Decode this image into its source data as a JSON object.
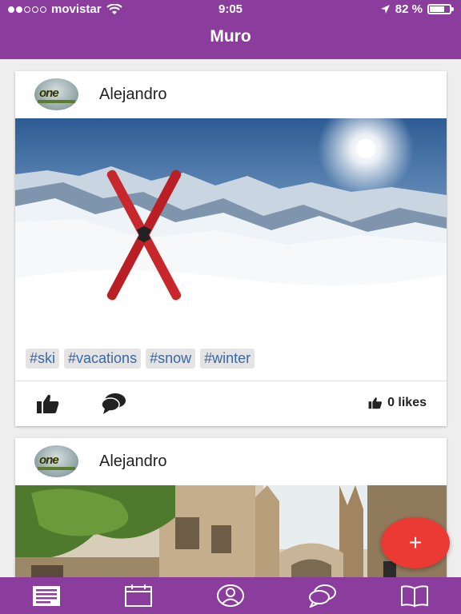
{
  "status": {
    "carrier": "movistar",
    "time": "9:05",
    "battery_text": "82 %",
    "battery_level": 0.82,
    "signal_bars": 2
  },
  "header": {
    "title": "Muro"
  },
  "posts": [
    {
      "author": "Alejandro",
      "avatar_text": "one",
      "tags": [
        "#ski",
        "#vacations",
        "#snow",
        "#winter"
      ],
      "likes_text": "0 likes"
    },
    {
      "author": "Alejandro",
      "avatar_text": "one"
    }
  ],
  "fab": {
    "label": "+"
  },
  "nav": {
    "items": [
      "news-icon",
      "calendar-icon",
      "profile-icon",
      "chat-icon",
      "book-icon"
    ],
    "active": "news-icon"
  },
  "colors": {
    "primary": "#8a3d9c",
    "fab": "#ea3a33",
    "tag_text": "#3a67a6",
    "tag_bg": "#e4e4e4"
  }
}
